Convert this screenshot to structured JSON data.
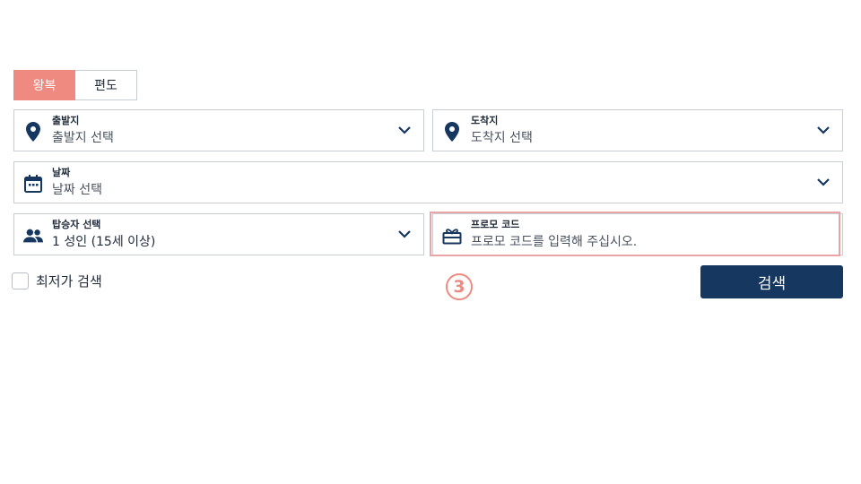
{
  "trip_tabs": [
    {
      "label": "왕복",
      "active": true
    },
    {
      "label": "편도",
      "active": false
    }
  ],
  "origin": {
    "label": "출발지",
    "value": "출발지 선택",
    "icon": "map-pin-icon"
  },
  "destination": {
    "label": "도착지",
    "value": "도착지 선택",
    "icon": "map-pin-icon"
  },
  "date": {
    "label": "날짜",
    "value": "날짜 선택",
    "icon": "calendar-icon"
  },
  "passengers": {
    "label": "탑승자 선택",
    "value": "1 성인 (15세 이상)",
    "icon": "people-icon"
  },
  "promo": {
    "label": "프로모 코드",
    "placeholder": "프로모 코드를 입력해 주십시오.",
    "icon": "gift-icon"
  },
  "lowest_fare": {
    "label": "최저가 검색",
    "checked": false
  },
  "annotation": {
    "marker": "③"
  },
  "search_button": {
    "label": "검색"
  },
  "colors": {
    "accent": "#ef8a80",
    "primary": "#16375f",
    "border": "#c9ced6"
  }
}
